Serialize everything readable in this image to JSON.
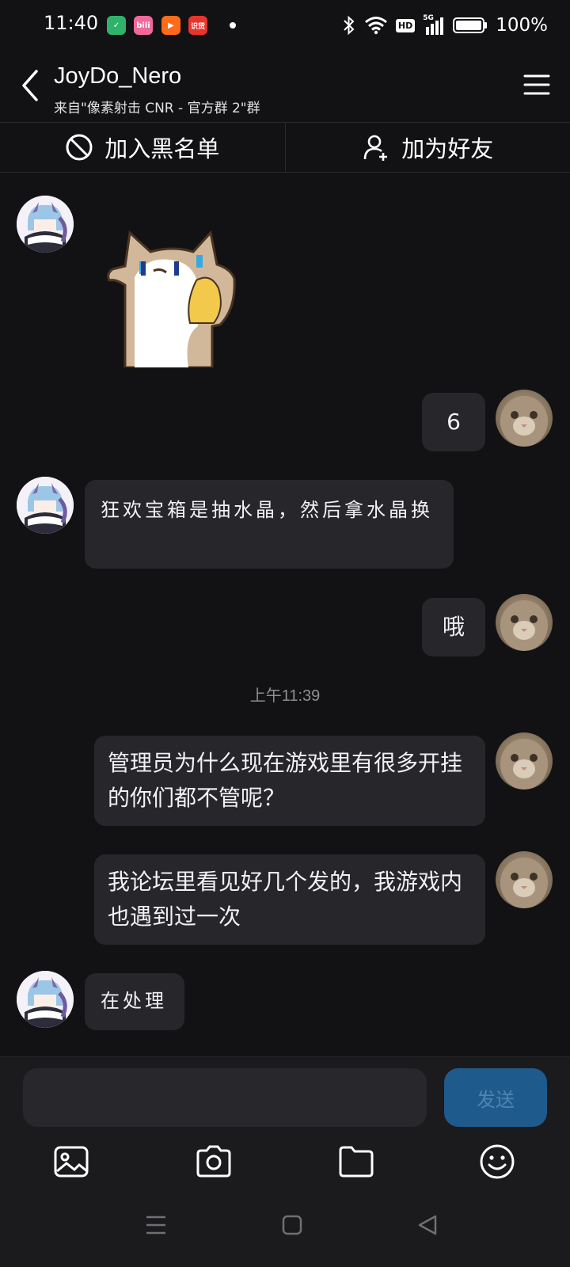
{
  "status_bar": {
    "time": "11:40",
    "apps": [
      {
        "name": "shield-app-icon",
        "color": "#2fb36b",
        "glyph": "✓"
      },
      {
        "name": "bilibili-app-icon",
        "color": "#f0699a",
        "glyph": "bili"
      },
      {
        "name": "kuaishou-app-icon",
        "color": "#ff6b1a",
        "glyph": "▶"
      },
      {
        "name": "shiyou-app-icon",
        "color": "#e8342d",
        "glyph": "识货"
      }
    ],
    "hd": "HD",
    "network": "5G",
    "battery": "100%"
  },
  "header": {
    "title": "JoyDo_Nero",
    "subtitle": "来自\"像素射击 CNR - 官方群 2\"群"
  },
  "actions": {
    "blacklist": "加入黑名单",
    "add_friend": "加为好友"
  },
  "messages": {
    "m1": "6",
    "m2": "狂欢宝箱是抽水晶，然后拿水晶换",
    "m3": "哦",
    "timestamp": "上午11:39",
    "m4": "管理员为什么现在游戏里有很多开挂的你们都不管呢？",
    "m5": "我论坛里看见好几个发的，我游戏内也遇到过一次",
    "m6": "在处理"
  },
  "input": {
    "placeholder": "",
    "send": "发送"
  },
  "colors": {
    "background": "#121214",
    "bubble": "#27272b",
    "send_button": "#1f5a8c"
  }
}
